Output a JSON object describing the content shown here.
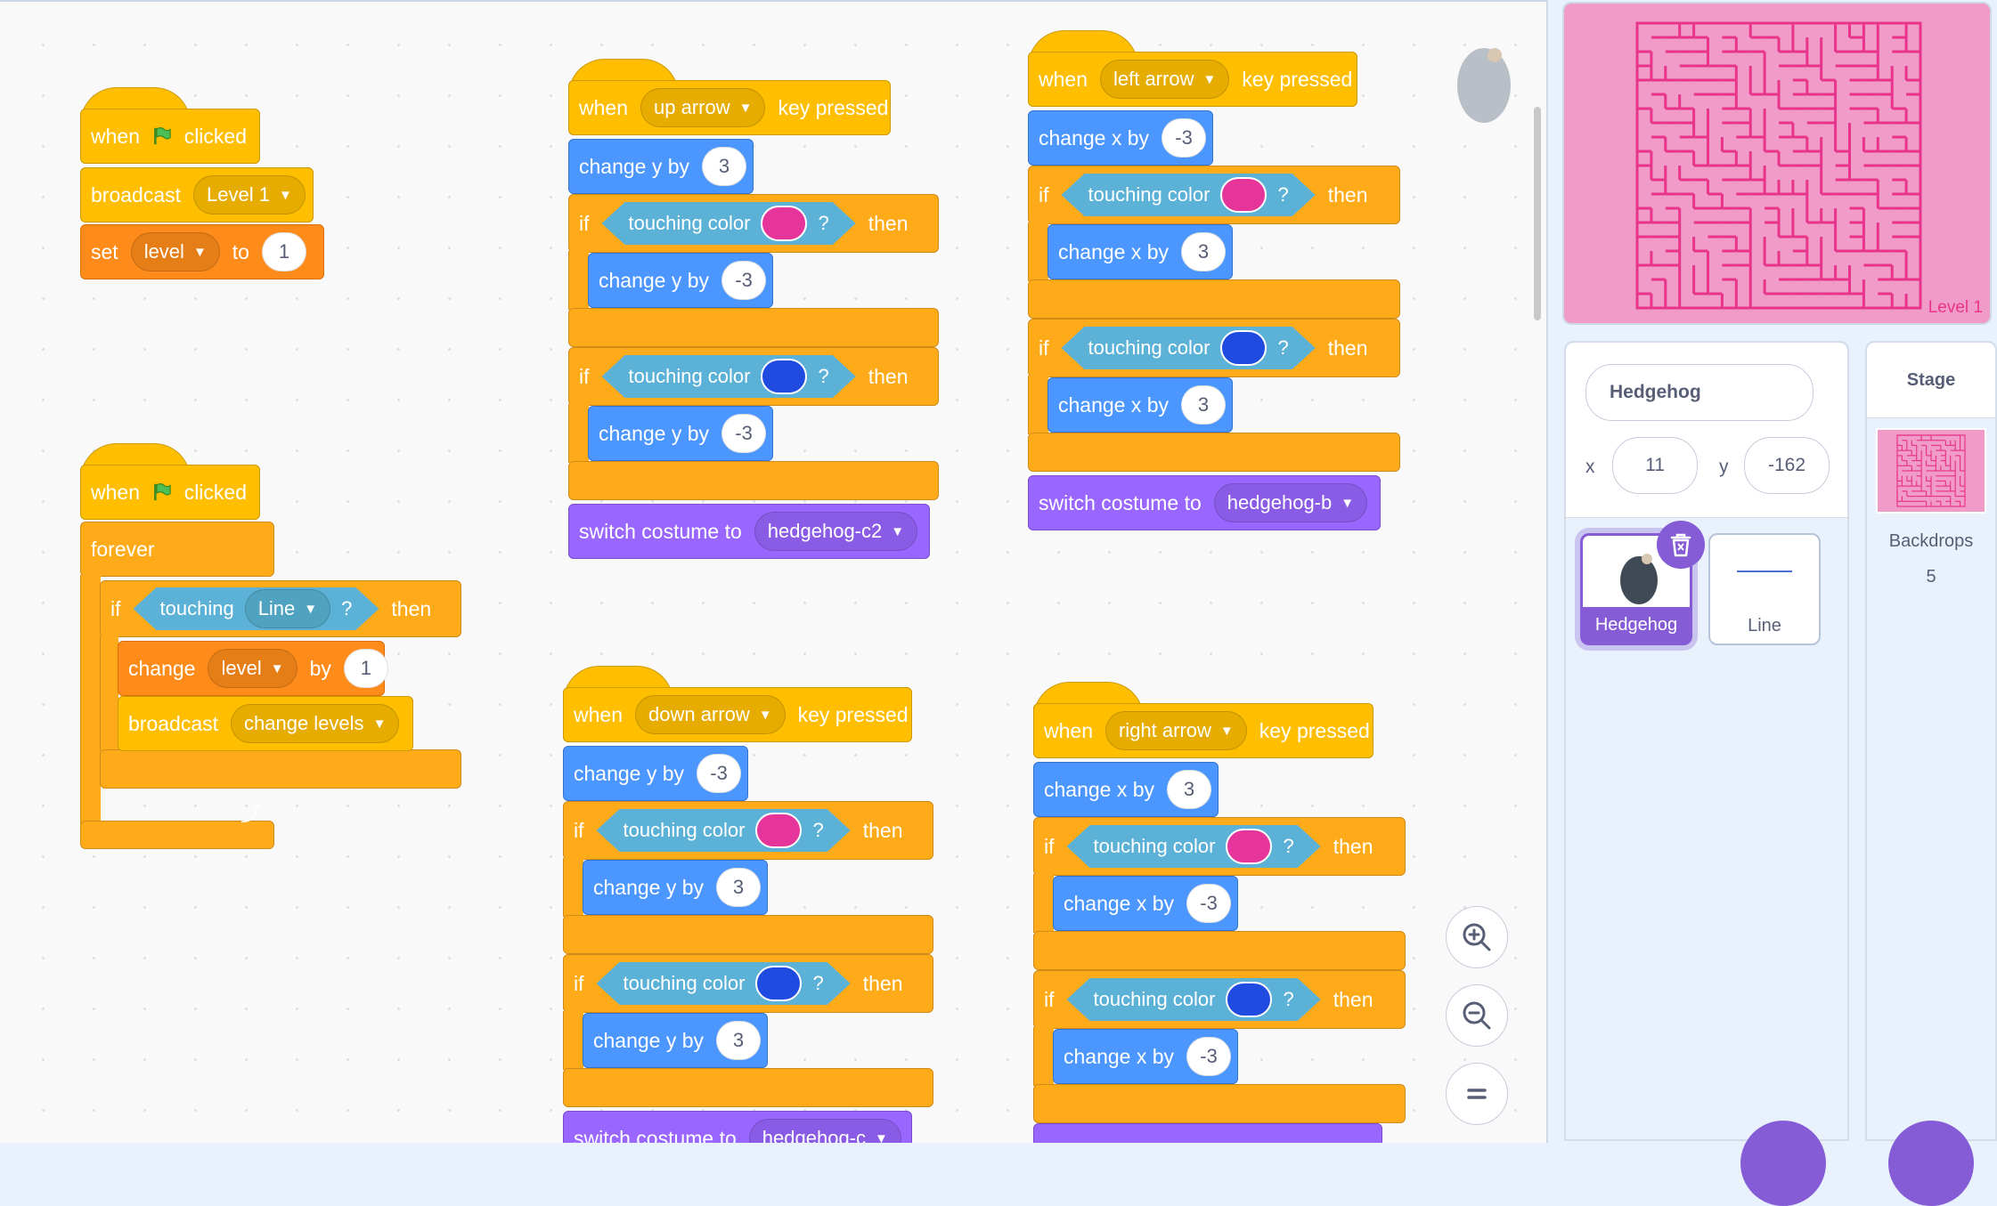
{
  "scripts": {
    "flag_script_1": {
      "hat": {
        "when": "when",
        "clicked": "clicked"
      },
      "broadcast": {
        "label": "broadcast",
        "message": "Level 1"
      },
      "set": {
        "label": "set",
        "variable": "level",
        "to": "to",
        "value": "1"
      }
    },
    "flag_script_2": {
      "hat": {
        "when": "when",
        "clicked": "clicked"
      },
      "forever": "forever",
      "if_label": "if",
      "touching": "touching",
      "object": "Line",
      "q": "?",
      "then": "then",
      "change": {
        "label": "change",
        "variable": "level",
        "by": "by",
        "value": "1"
      },
      "broadcast": {
        "label": "broadcast",
        "message": "change levels"
      }
    },
    "up_script": {
      "when": "when",
      "key": "up arrow",
      "pressed": "key pressed",
      "move": {
        "label": "change y by",
        "value": "3"
      },
      "if1": {
        "if": "if",
        "cond": "touching color",
        "q": "?",
        "then": "then",
        "color": "#e6359a",
        "inner_label": "change y by",
        "inner_value": "-3"
      },
      "if2": {
        "if": "if",
        "cond": "touching color",
        "q": "?",
        "then": "then",
        "color": "#1f4be0",
        "inner_label": "change y by",
        "inner_value": "-3"
      },
      "costume": {
        "label": "switch costume to",
        "value": "hedgehog-c2"
      }
    },
    "left_script": {
      "when": "when",
      "key": "left arrow",
      "pressed": "key pressed",
      "move": {
        "label": "change x by",
        "value": "-3"
      },
      "if1": {
        "if": "if",
        "cond": "touching color",
        "q": "?",
        "then": "then",
        "color": "#e6359a",
        "inner_label": "change x by",
        "inner_value": "3"
      },
      "if2": {
        "if": "if",
        "cond": "touching color",
        "q": "?",
        "then": "then",
        "color": "#1f4be0",
        "inner_label": "change x by",
        "inner_value": "3"
      },
      "costume": {
        "label": "switch costume to",
        "value": "hedgehog-b"
      }
    },
    "down_script": {
      "when": "when",
      "key": "down arrow",
      "pressed": "key pressed",
      "move": {
        "label": "change y by",
        "value": "-3"
      },
      "if1": {
        "if": "if",
        "cond": "touching color",
        "q": "?",
        "then": "then",
        "color": "#e6359a",
        "inner_label": "change y by",
        "inner_value": "3"
      },
      "if2": {
        "if": "if",
        "cond": "touching color",
        "q": "?",
        "then": "then",
        "color": "#1f4be0",
        "inner_label": "change y by",
        "inner_value": "3"
      },
      "costume": {
        "label": "switch costume to",
        "value": "hedgehog-c"
      }
    },
    "right_script": {
      "when": "when",
      "key": "right arrow",
      "pressed": "key pressed",
      "move": {
        "label": "change x by",
        "value": "3"
      },
      "if1": {
        "if": "if",
        "cond": "touching color",
        "q": "?",
        "then": "then",
        "color": "#e6359a",
        "inner_label": "change x by",
        "inner_value": "-3"
      },
      "if2": {
        "if": "if",
        "cond": "touching color",
        "q": "?",
        "then": "then",
        "color": "#1f4be0",
        "inner_label": "change x by",
        "inner_value": "-3"
      }
    }
  },
  "stage": {
    "level_text": "Level 1",
    "background": "#f19cc8",
    "maze_color": "#e8348a"
  },
  "sprite_info": {
    "name": "Hedgehog",
    "x_label": "x",
    "x_value": "11",
    "y_label": "y",
    "y_value": "-162"
  },
  "sprites": [
    {
      "name": "Hedgehog",
      "selected": true
    },
    {
      "name": "Line",
      "selected": false
    }
  ],
  "stage_pane": {
    "title": "Stage",
    "backdrops_label": "Backdrops",
    "backdrops_count": "5"
  },
  "colors": {
    "events": "#ffbf00",
    "motion": "#4c97ff",
    "control": "#ffab19",
    "variables": "#ff8c1a",
    "looks": "#9966ff",
    "sensing": "#5cb1d6",
    "accent": "#855cd6"
  }
}
